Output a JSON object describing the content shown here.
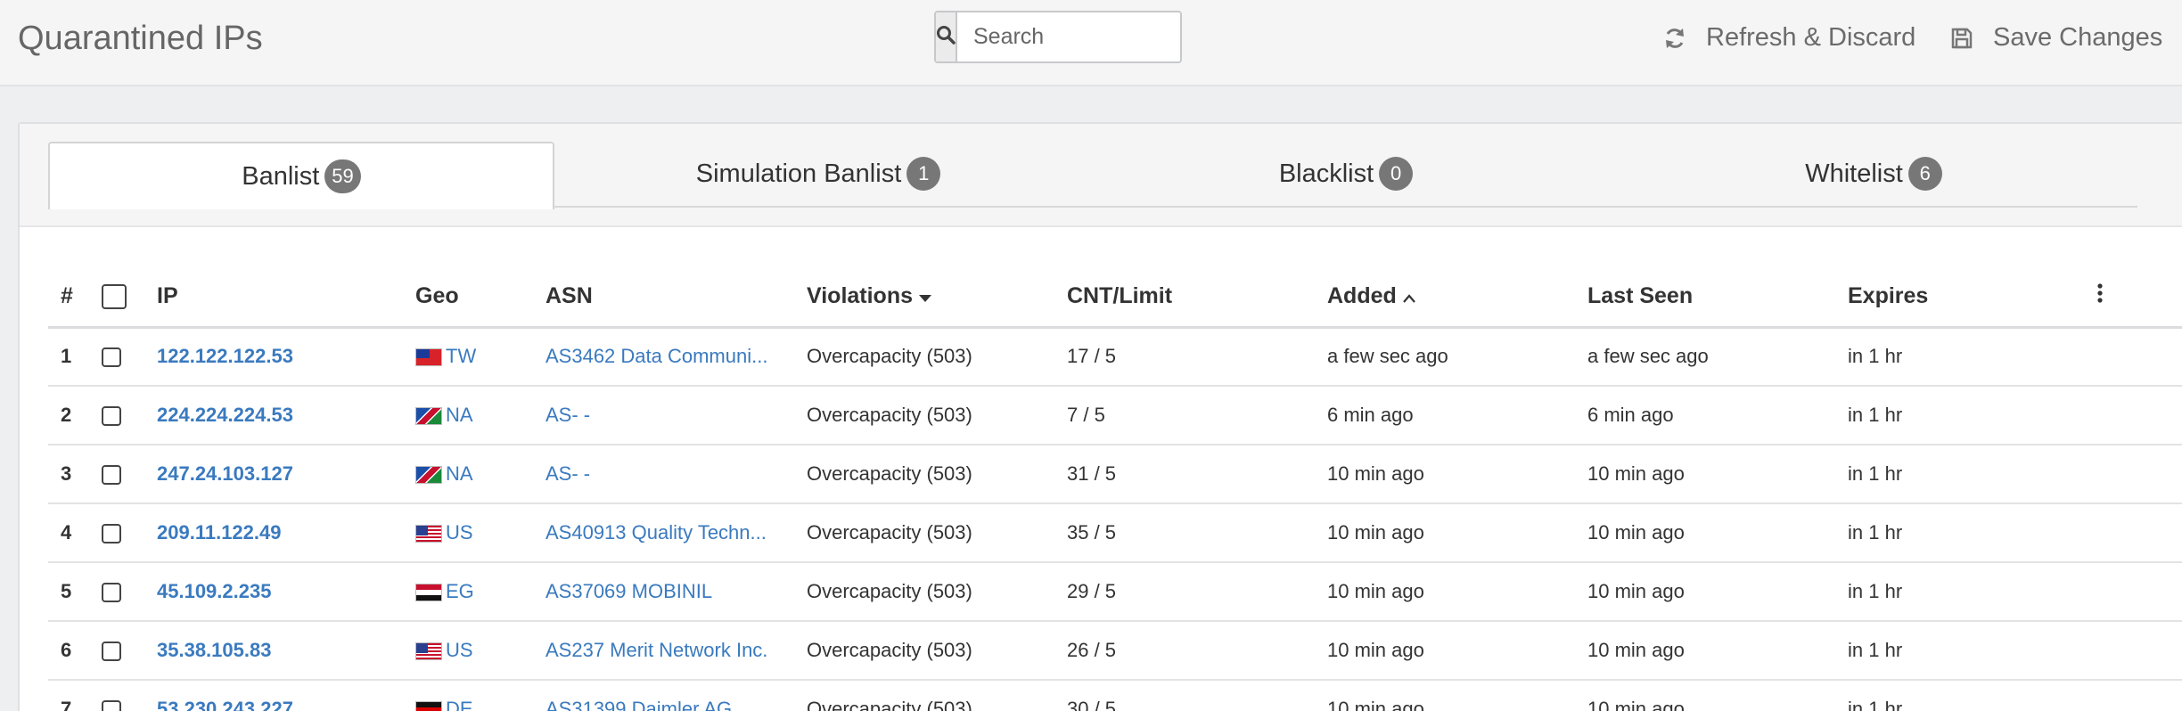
{
  "header": {
    "title": "Quarantined IPs",
    "search_placeholder": "Search",
    "refresh_label": "Refresh & Discard",
    "save_label": "Save Changes"
  },
  "tabs": [
    {
      "label": "Banlist",
      "count": "59",
      "active": true
    },
    {
      "label": "Simulation Banlist",
      "count": "1",
      "active": false
    },
    {
      "label": "Blacklist",
      "count": "0",
      "active": false
    },
    {
      "label": "Whitelist",
      "count": "6",
      "active": false
    }
  ],
  "table": {
    "columns": {
      "num": "#",
      "ip": "IP",
      "geo": "Geo",
      "asn": "ASN",
      "violations": "Violations",
      "cnt": "CNT/Limit",
      "added": "Added",
      "last_seen": "Last Seen",
      "expires": "Expires"
    },
    "sort": {
      "violations": "descending",
      "added": "ascending"
    },
    "rows": [
      {
        "num": "1",
        "ip": "122.122.122.53",
        "flag": "flag-tw",
        "geo": "TW",
        "asn": "AS3462 Data Communi...",
        "violations": "Overcapacity (503)",
        "cnt": "17 / 5",
        "added": "a few sec ago",
        "last_seen": "a few sec ago",
        "expires": "in 1 hr"
      },
      {
        "num": "2",
        "ip": "224.224.224.53",
        "flag": "flag-na",
        "geo": "NA",
        "asn": "AS- -",
        "violations": "Overcapacity (503)",
        "cnt": "7 / 5",
        "added": "6 min ago",
        "last_seen": "6 min ago",
        "expires": "in 1 hr"
      },
      {
        "num": "3",
        "ip": "247.24.103.127",
        "flag": "flag-na",
        "geo": "NA",
        "asn": "AS- -",
        "violations": "Overcapacity (503)",
        "cnt": "31 / 5",
        "added": "10 min ago",
        "last_seen": "10 min ago",
        "expires": "in 1 hr"
      },
      {
        "num": "4",
        "ip": "209.11.122.49",
        "flag": "flag-us",
        "geo": "US",
        "asn": "AS40913 Quality Techn...",
        "violations": "Overcapacity (503)",
        "cnt": "35 / 5",
        "added": "10 min ago",
        "last_seen": "10 min ago",
        "expires": "in 1 hr"
      },
      {
        "num": "5",
        "ip": "45.109.2.235",
        "flag": "flag-eg",
        "geo": "EG",
        "asn": "AS37069 MOBINIL",
        "violations": "Overcapacity (503)",
        "cnt": "29 / 5",
        "added": "10 min ago",
        "last_seen": "10 min ago",
        "expires": "in 1 hr"
      },
      {
        "num": "6",
        "ip": "35.38.105.83",
        "flag": "flag-us",
        "geo": "US",
        "asn": "AS237 Merit Network Inc.",
        "violations": "Overcapacity (503)",
        "cnt": "26 / 5",
        "added": "10 min ago",
        "last_seen": "10 min ago",
        "expires": "in 1 hr"
      },
      {
        "num": "7",
        "ip": "53.230.243.227",
        "flag": "flag-de",
        "geo": "DE",
        "asn": "AS31399 Daimler AG",
        "violations": "Overcapacity (503)",
        "cnt": "30 / 5",
        "added": "10 min ago",
        "last_seen": "10 min ago",
        "expires": "in 1 hr"
      }
    ]
  },
  "icons": {
    "search": "search-icon",
    "refresh": "refresh-icon",
    "save": "save-icon",
    "menu": "kebab-menu-icon",
    "sort_desc": "caret-down-icon",
    "sort_asc": "chevron-up-icon"
  },
  "colors": {
    "link": "#3a7abf",
    "badge": "#777777",
    "page_bg": "#eeeff0"
  }
}
